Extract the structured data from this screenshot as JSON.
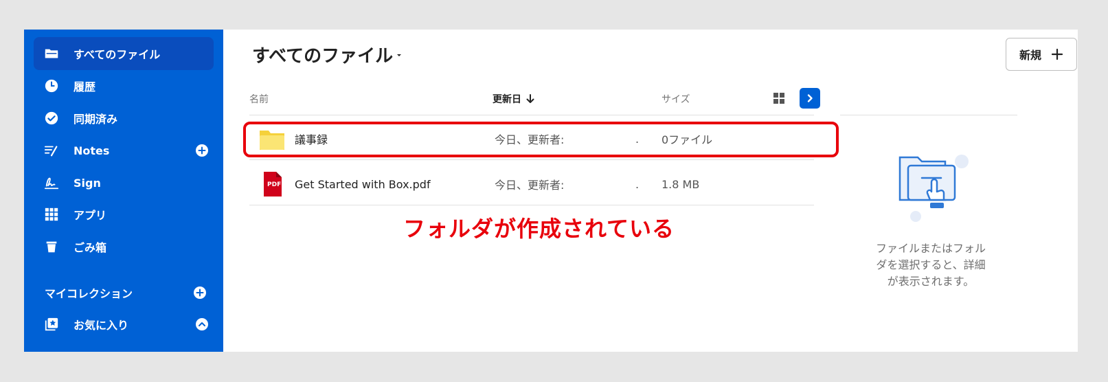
{
  "sidebar": {
    "items": [
      {
        "label": "すべてのファイル",
        "icon": "folder-icon",
        "active": true
      },
      {
        "label": "履歴",
        "icon": "clock-icon"
      },
      {
        "label": "同期済み",
        "icon": "check-circle-icon"
      },
      {
        "label": "Notes",
        "icon": "notes-icon",
        "has_add": true
      },
      {
        "label": "Sign",
        "icon": "signature-icon"
      },
      {
        "label": "アプリ",
        "icon": "apps-grid-icon"
      },
      {
        "label": "ごみ箱",
        "icon": "trash-icon"
      }
    ],
    "section_label": "マイコレクション",
    "favorites": {
      "label": "お気に入り",
      "icon": "star-collection-icon"
    }
  },
  "main": {
    "title": "すべてのファイル",
    "new_button": "新規",
    "columns": {
      "name": "名前",
      "modified": "更新日",
      "size": "サイズ"
    },
    "rows": [
      {
        "name": "議事録",
        "type": "folder",
        "modified": "今日、更新者:",
        "dot": ".",
        "size": "0ファイル"
      },
      {
        "name": "Get Started with Box.pdf",
        "type": "pdf",
        "modified": "今日、更新者:",
        "dot": ".",
        "size": "1.8 MB"
      }
    ],
    "pdf_badge": "PDF"
  },
  "annotation": "フォルダが作成されている",
  "details_panel": {
    "lines": [
      "ファイルまたはフォル",
      "ダを選択すると、詳細",
      "が表示されます。"
    ]
  },
  "colors": {
    "brand": "#0061d5",
    "annotation": "#e8000b"
  }
}
